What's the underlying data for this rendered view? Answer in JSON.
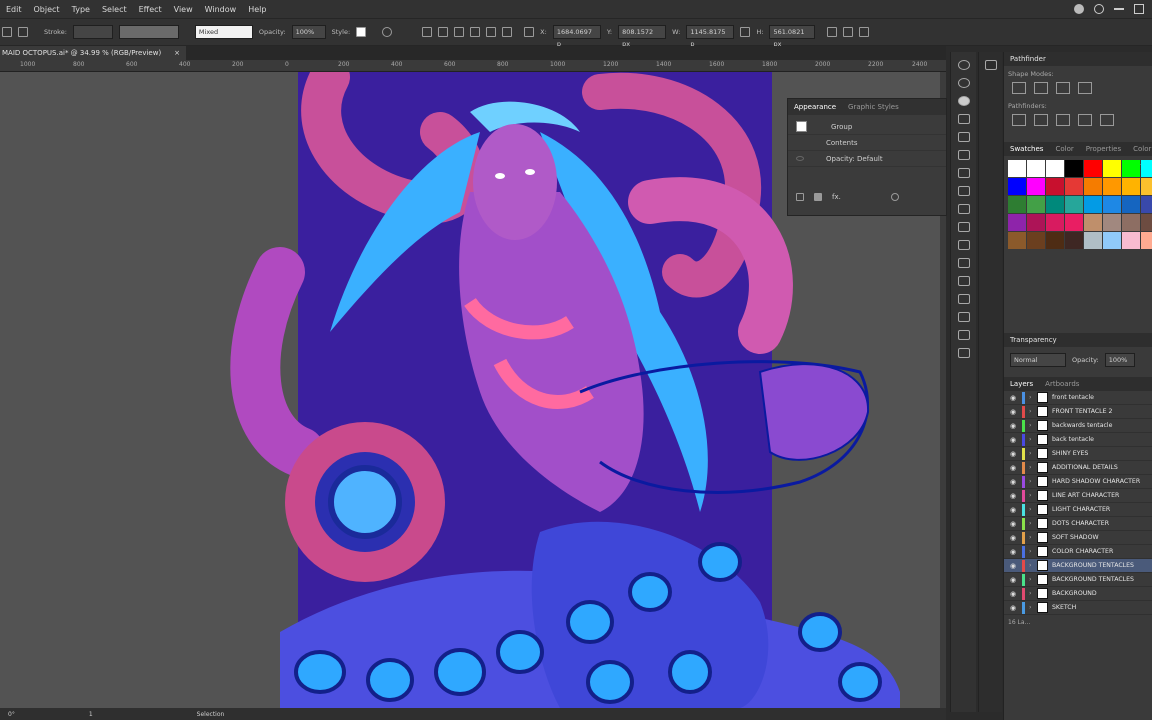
{
  "menu": [
    "Edit",
    "Object",
    "Type",
    "Select",
    "Effect",
    "View",
    "Window",
    "Help"
  ],
  "control": {
    "stroke_label": "Stroke:",
    "mixed_value": "Mixed",
    "opacity_label": "Opacity:",
    "opacity_value": "100%",
    "style_label": "Style:",
    "x_label": "X:",
    "x_value": "1684.0697 p",
    "y_label": "Y:",
    "y_value": "808.1572 px",
    "w_label": "W:",
    "w_value": "1145.8175 p",
    "h_label": "H:",
    "h_value": "561.0821 px"
  },
  "document": {
    "tab_title": "MAID OCTOPUS.ai* @ 34.99 % (RGB/Preview)",
    "close": "×"
  },
  "ruler": [
    "1000",
    "800",
    "600",
    "400",
    "200",
    "0",
    "200",
    "400",
    "600",
    "800",
    "1000",
    "1200",
    "1400",
    "1600",
    "1800",
    "2000",
    "2200",
    "2400"
  ],
  "status": {
    "zoom": "0°",
    "page": "1",
    "tool": "Selection"
  },
  "appearance": {
    "tabs": [
      "Appearance",
      "Graphic Styles"
    ],
    "group": "Group",
    "contents": "Contents",
    "opacity": "Opacity: Default",
    "fx": "fx."
  },
  "pathfinder": {
    "title": "Pathfinder",
    "shape_modes": "Shape Modes:",
    "pathfinders": "Pathfinders:"
  },
  "swatch_tabs": [
    "Swatches",
    "Color",
    "Properties",
    "Color Gu"
  ],
  "swatch_colors": [
    "#ffffff",
    "#ffffff",
    "#ffffff",
    "#000000",
    "#ff0000",
    "#ffff00",
    "#00ff00",
    "#00ffff",
    "#0000ff",
    "#ff00ff",
    "#c8102e",
    "#e53935",
    "#f57c00",
    "#ff9800",
    "#ffb300",
    "#fbc02d",
    "#2e7d32",
    "#43a047",
    "#00897b",
    "#26a69a",
    "#039be5",
    "#1e88e5",
    "#1565c0",
    "#3949ab",
    "#8e24aa",
    "#ad1457",
    "#d81b60",
    "#e91e63",
    "#bf8f6b",
    "#a1887f",
    "#8d6e63",
    "#6d4c41",
    "#8b5a2b",
    "#6b3f1f",
    "#4e2c14",
    "#3e2723",
    "#b0bec5",
    "#90caf9",
    "#f8bbd0",
    "#ffab91"
  ],
  "transparency": {
    "title": "Transparency",
    "mode": "Normal",
    "opacity_label": "Opacity:",
    "opacity_value": "100%"
  },
  "layers_tabs": [
    "Layers",
    "Artboards"
  ],
  "layers": [
    {
      "name": "front tentacle",
      "color": "#4a90e2"
    },
    {
      "name": "FRONT TENTACLE 2",
      "color": "#e24a4a"
    },
    {
      "name": "backwards tentacle",
      "color": "#4ae24a"
    },
    {
      "name": "back tentacle",
      "color": "#4a4ae2"
    },
    {
      "name": "SHINY EYES",
      "color": "#e2e24a"
    },
    {
      "name": "ADDITIONAL DETAILS",
      "color": "#e28a4a"
    },
    {
      "name": "HARD SHADOW CHARACTER",
      "color": "#9a4ae2"
    },
    {
      "name": "LINE ART CHARACTER",
      "color": "#e24a9a"
    },
    {
      "name": "LIGHT CHARACTER",
      "color": "#4ae2e2"
    },
    {
      "name": "DOTS CHARACTER",
      "color": "#8ae24a"
    },
    {
      "name": "SOFT SHADOW",
      "color": "#e2a04a"
    },
    {
      "name": "COLOR CHARACTER",
      "color": "#4a70e2"
    },
    {
      "name": "BACKGROUND TENTACLES",
      "color": "#e24a4a"
    },
    {
      "name": "BACKGROUND TENTACLES",
      "color": "#4ae28a"
    },
    {
      "name": "BACKGROUND",
      "color": "#e24a70"
    },
    {
      "name": "SKETCH",
      "color": "#4a9ae2"
    }
  ],
  "layers_footer": "16 La..."
}
